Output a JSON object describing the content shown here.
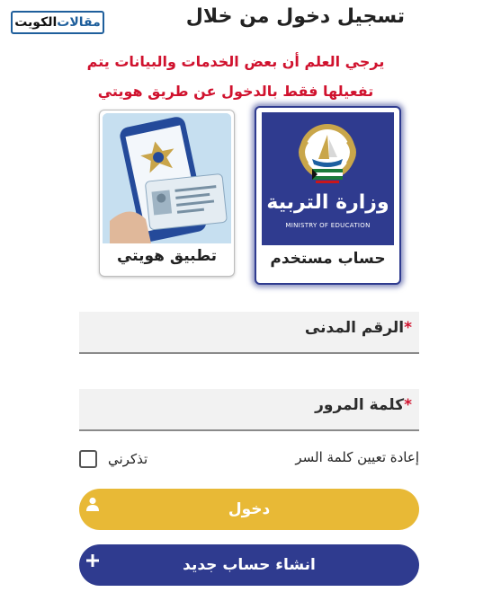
{
  "watermark": {
    "part1": "مقالات",
    "part2": "الكويت"
  },
  "header": {
    "title": "تسجيل دخول من خلال",
    "notice_line1": "يرجي العلم أن بعض الخدمات والبيانات يتم",
    "notice_line2": "تفعيلها فقط بالدخول عن طريق هويتي"
  },
  "login_options": [
    {
      "label": "حساب مستخدم",
      "logo_text_ar": "وزارة التربية",
      "logo_text_en": "MINISTRY OF EDUCATION",
      "logo_bg": "#2f3b8f",
      "selected": true
    },
    {
      "label": "تطبيق هويتي",
      "selected": false
    }
  ],
  "form": {
    "civil_id_label": "الرقم المدنى",
    "password_label": "كلمة المرور",
    "required_mark": "*",
    "civil_id_value": "",
    "password_value": "",
    "forgot_password": "إعادة تعيين كلمة السر",
    "remember_me": "تذكرني",
    "remember_checked": false
  },
  "buttons": {
    "login": "دخول",
    "login_icon": "user-icon",
    "new_account": "انشاء حساب جديد",
    "new_account_icon": "plus-icon"
  },
  "colors": {
    "accent_blue": "#2f3b8f",
    "accent_gold": "#e8b936",
    "notice_red": "#d0122e"
  }
}
